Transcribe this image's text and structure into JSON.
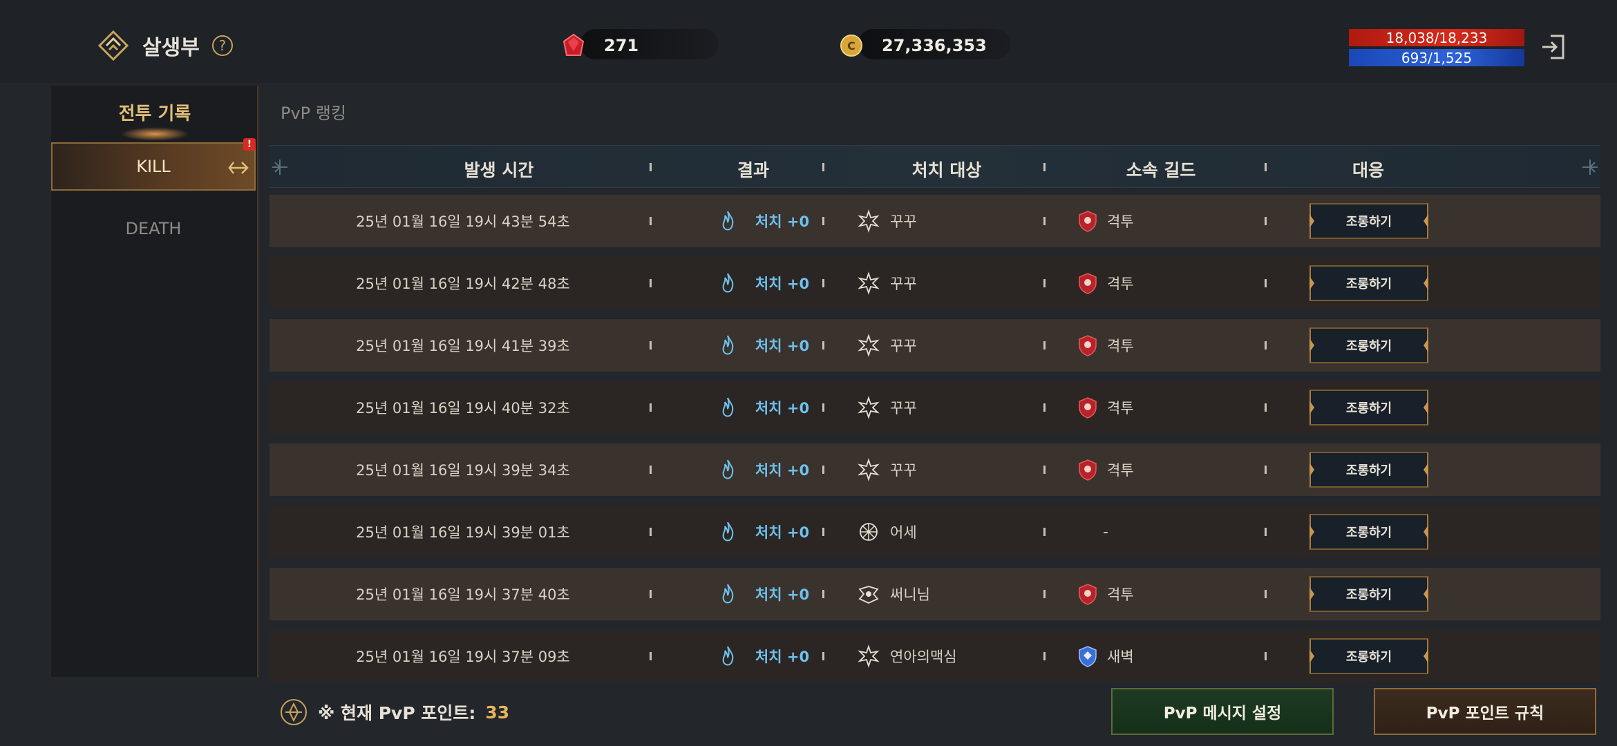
{
  "header": {
    "title": "살생부",
    "help_label": "?",
    "gems": "271",
    "gold": "27,336,353",
    "hp": "18,038/18,233",
    "mp": "693/1,525"
  },
  "sidebar": {
    "heading": "전투 기록",
    "tabs": [
      {
        "label": "KILL",
        "active": true,
        "badge": "!"
      },
      {
        "label": "DEATH",
        "active": false
      }
    ]
  },
  "section_tab": "PvP 랭킹",
  "table": {
    "columns": [
      "발생 시간",
      "결과",
      "처치 대상",
      "소속 길드",
      "대응"
    ],
    "rows": [
      {
        "time": "25년 01월 16일 19시 43분 54초",
        "result": "처치 +0",
        "target": "꾸꾸",
        "guild": "격투",
        "guild_icon": "red-shield",
        "action": "조롱하기"
      },
      {
        "time": "25년 01월 16일 19시 42분 48초",
        "result": "처치 +0",
        "target": "꾸꾸",
        "guild": "격투",
        "guild_icon": "red-shield",
        "action": "조롱하기"
      },
      {
        "time": "25년 01월 16일 19시 41분 39초",
        "result": "처치 +0",
        "target": "꾸꾸",
        "guild": "격투",
        "guild_icon": "red-shield",
        "action": "조롱하기"
      },
      {
        "time": "25년 01월 16일 19시 40분 32초",
        "result": "처치 +0",
        "target": "꾸꾸",
        "guild": "격투",
        "guild_icon": "red-shield",
        "action": "조롱하기"
      },
      {
        "time": "25년 01월 16일 19시 39분 34초",
        "result": "처치 +0",
        "target": "꾸꾸",
        "guild": "격투",
        "guild_icon": "red-shield",
        "action": "조롱하기"
      },
      {
        "time": "25년 01월 16일 19시 39분 01초",
        "result": "처치 +0",
        "target": "어세",
        "guild": "-",
        "guild_icon": "",
        "action": "조롱하기"
      },
      {
        "time": "25년 01월 16일 19시 37분 40초",
        "result": "처치 +0",
        "target": "써니님",
        "guild": "격투",
        "guild_icon": "red-shield",
        "action": "조롱하기"
      },
      {
        "time": "25년 01월 16일 19시 37분 09초",
        "result": "처치 +0",
        "target": "연아의맥심",
        "guild": "새벽",
        "guild_icon": "blue-shield",
        "action": "조롱하기"
      }
    ]
  },
  "footer": {
    "points_label": "※ 현재 PvP 포인트:",
    "points_value": "33",
    "message_button": "PvP 메시지 설정",
    "rules_button": "PvP 포인트 규칙"
  },
  "colors": {
    "accent_gold": "#e2bf77",
    "result_blue": "#6fc2ee",
    "row_alt": "#3a322d",
    "row_norm": "#2b2623"
  }
}
